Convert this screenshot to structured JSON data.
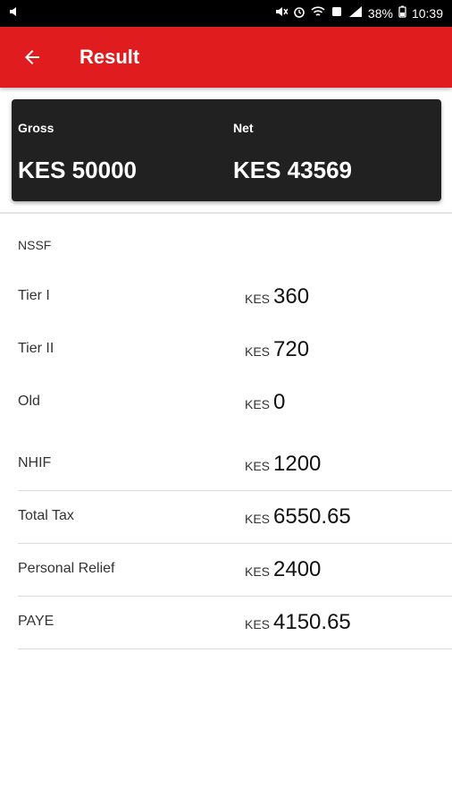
{
  "status_bar": {
    "battery": "38%",
    "time": "10:39",
    "icons": [
      "volume-icon",
      "mute-icon",
      "alarm-icon",
      "wifi-icon",
      "screenshot-icon",
      "signal-icon",
      "battery-icon"
    ]
  },
  "app_bar": {
    "title": "Result",
    "back_icon": "arrow-back-icon"
  },
  "summary": {
    "gross_label": "Gross",
    "gross_value": "KES 50000",
    "net_label": "Net",
    "net_value": "KES 43569"
  },
  "sections": {
    "nssf_label": "NSSF"
  },
  "rows": [
    {
      "label": "Tier I",
      "currency": "KES",
      "value": "360"
    },
    {
      "label": "Tier II",
      "currency": "KES",
      "value": "720"
    },
    {
      "label": "Old",
      "currency": "KES",
      "value": "0"
    },
    {
      "label": "NHIF",
      "currency": "KES",
      "value": "1200"
    },
    {
      "label": "Total Tax",
      "currency": "KES",
      "value": "6550.65"
    },
    {
      "label": "Personal Relief",
      "currency": "KES",
      "value": "2400"
    },
    {
      "label": "PAYE",
      "currency": "KES",
      "value": "4150.65"
    }
  ],
  "colors": {
    "app_bar": "#e11c1e",
    "summary_card": "#212121"
  }
}
